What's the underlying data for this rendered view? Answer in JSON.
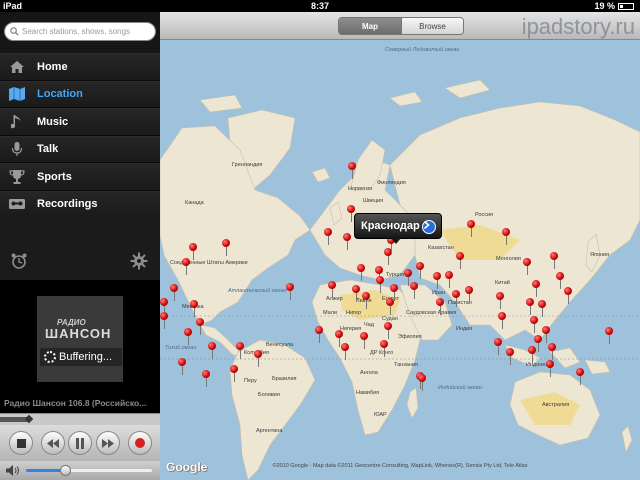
{
  "status": {
    "device": "iPad",
    "time": "8:37",
    "battery": "19 %"
  },
  "search": {
    "placeholder": "Search stations, shows, songs"
  },
  "menu": [
    {
      "label": "Home",
      "icon": "home-icon"
    },
    {
      "label": "Location",
      "icon": "map-icon",
      "active": true
    },
    {
      "label": "Music",
      "icon": "music-note-icon"
    },
    {
      "label": "Talk",
      "icon": "microphone-icon"
    },
    {
      "label": "Sports",
      "icon": "trophy-icon"
    },
    {
      "label": "Recordings",
      "icon": "cassette-icon"
    }
  ],
  "player": {
    "artwork_line1": "РАДИО",
    "artwork_line2": "ШАНСОН",
    "buffering": "Buffering...",
    "station": "Радио Шансон 106.8 (Российско...",
    "progress_fraction": 0.18,
    "volume_fraction": 0.31
  },
  "toolbar": {
    "map_tab": "Map",
    "browse_tab": "Browse",
    "selected": "Map"
  },
  "watermark": "ipadstory.ru",
  "map": {
    "callout": "Краснодар",
    "google_logo": "Google",
    "copyright": "©2010 Google - Map data ©2011 Geocentre Consulting, MapLink, Whereis(R), Sensis Pty Ltd, Tele Atlas",
    "labels": [
      {
        "text": "Северный Ледовитый океан"
      },
      {
        "text": "Гренландия"
      },
      {
        "text": "Россия"
      },
      {
        "text": "Канада"
      },
      {
        "text": "Казахстан"
      },
      {
        "text": "Монголия"
      },
      {
        "text": "Китай"
      },
      {
        "text": "Индия"
      },
      {
        "text": "Атлантический океан"
      },
      {
        "text": "Тихий океан"
      },
      {
        "text": "Индийский океан"
      },
      {
        "text": "Алжир"
      },
      {
        "text": "Ливия"
      },
      {
        "text": "Египет"
      },
      {
        "text": "Мали"
      },
      {
        "text": "Нигер"
      },
      {
        "text": "Чад"
      },
      {
        "text": "Судан"
      },
      {
        "text": "Нигерия"
      },
      {
        "text": "Эфиопия"
      },
      {
        "text": "ДР Конго"
      },
      {
        "text": "Ангола"
      },
      {
        "text": "Намибия"
      },
      {
        "text": "ЮАР"
      },
      {
        "text": "Танзания"
      },
      {
        "text": "Бразилия"
      },
      {
        "text": "Перу"
      },
      {
        "text": "Боливия"
      },
      {
        "text": "Аргентина"
      },
      {
        "text": "Колумбия"
      },
      {
        "text": "Венесуэла"
      },
      {
        "text": "Мексика"
      },
      {
        "text": "Соединенные Штаты Америки"
      },
      {
        "text": "Саудовская Аравия"
      },
      {
        "text": "Иран"
      },
      {
        "text": "Пакистан"
      },
      {
        "text": "Турция"
      },
      {
        "text": "Индонезия"
      },
      {
        "text": "Австралия"
      },
      {
        "text": "Норвегия"
      },
      {
        "text": "Швеция"
      },
      {
        "text": "Финляндия"
      },
      {
        "text": "Япония"
      }
    ]
  }
}
